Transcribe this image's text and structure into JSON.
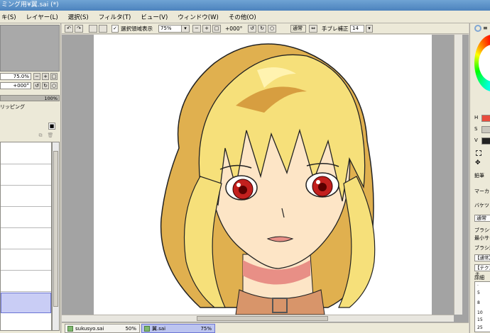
{
  "window": {
    "title": "ミング用¥翼.sai (*)"
  },
  "menu": [
    "キ(S)",
    "レイヤー(L)",
    "選択(S)",
    "フィルタ(T)",
    "ビュー(V)",
    "ウィンドウ(W)",
    "その他(O)"
  ],
  "navigator": {
    "zoom": "75.0%",
    "angle": "+000°"
  },
  "layer_panel": {
    "opacity": "100%",
    "clipping_label": "リッピング",
    "layer_count": 8,
    "selected_index": 7
  },
  "canvas_toolbar": {
    "show_selection_label": "選択領域表示",
    "zoom_value": "75%",
    "angle_value": "+000°",
    "blend_mode": "通常",
    "stabilizer_label": "手ブレ補正",
    "stabilizer_value": "14"
  },
  "documents": [
    {
      "name": "sukusyo.sai",
      "zoom": "50%",
      "active": false
    },
    {
      "name": "翼.sai",
      "zoom": "75%",
      "active": true
    }
  ],
  "right_panel": {
    "hsv": [
      "H",
      "S",
      "V"
    ],
    "tools": [
      "鉛筆",
      "マーカー",
      "バケツ"
    ],
    "blend_mode": "通常",
    "brush_size_label": "ブラシサ",
    "min_size_label": "最小サイ",
    "brush_density_label": "ブラシ濃",
    "texture_none": "【通常】",
    "texture_label": "【テクスチ",
    "detail_label": "詳細",
    "sizes": [
      "5",
      "8",
      "10",
      "15",
      "25"
    ]
  },
  "colors": {
    "hair": "#f6e07a",
    "hair_shadow": "#d79e40",
    "skin": "#fde5c6",
    "skin_shadow": "#e88f86",
    "eye": "#c3201e",
    "collar": "#d8956a",
    "selection_accent": "#6b74d4"
  }
}
